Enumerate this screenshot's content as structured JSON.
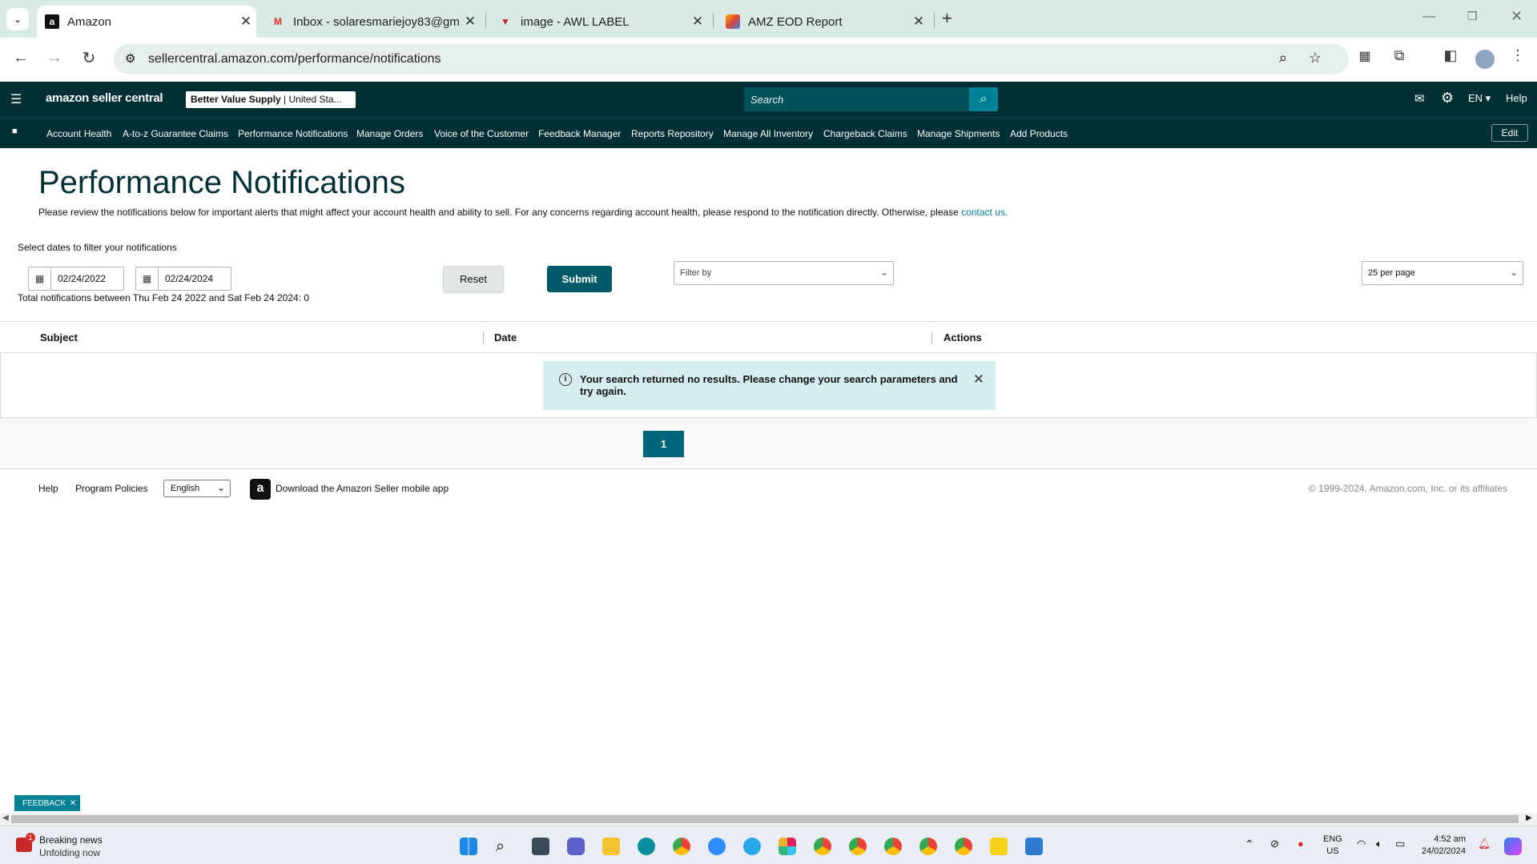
{
  "browser": {
    "tabs": [
      {
        "title": "Amazon",
        "active": true
      },
      {
        "title": "Inbox - solaresmariejoy83@gm",
        "active": false
      },
      {
        "title": "image - AWL LABEL",
        "active": false
      },
      {
        "title": "AMZ EOD Report",
        "active": false
      }
    ],
    "new_tab": "+",
    "url": "sellercentral.amazon.com/performance/notifications"
  },
  "header": {
    "logo": "amazon seller central",
    "store_name": "Better Value Supply",
    "store_region": "United Sta...",
    "search_placeholder": "Search",
    "language": "EN",
    "help": "Help"
  },
  "nav": {
    "items": [
      "Account Health",
      "A-to-z Guarantee Claims",
      "Performance Notifications",
      "Manage Orders",
      "Voice of the Customer",
      "Feedback Manager",
      "Reports Repository",
      "Manage All Inventory",
      "Chargeback Claims",
      "Manage Shipments",
      "Add Products"
    ],
    "edit": "Edit"
  },
  "page": {
    "title": "Performance Notifications",
    "intro": "Please review the notifications below for important alerts that might affect your account health and ability to sell. For any concerns regarding account health, please respond to the notification directly. Otherwise, please ",
    "contact_link": "contact us.",
    "date_filter_label": "Select dates to filter your notifications",
    "start_date": "02/24/2022",
    "end_date": "02/24/2024",
    "total_text": "Total notifications between Thu Feb 24 2022 and Sat Feb 24 2024: 0",
    "reset": "Reset",
    "submit": "Submit",
    "filter_placeholder": "Filter by",
    "per_page": "25 per page"
  },
  "table": {
    "columns": [
      "Subject",
      "Date",
      "Actions"
    ],
    "empty_message": "Your search returned no results. Please change your search parameters and try again."
  },
  "pagination": {
    "current": "1"
  },
  "footer": {
    "help": "Help",
    "policies": "Program Policies",
    "language": "English",
    "app_link": "Download the Amazon Seller mobile app",
    "copyright": "© 1999-2024, Amazon.com, Inc. or its affiliates"
  },
  "feedback": "FEEDBACK",
  "taskbar": {
    "news_title": "Breaking news",
    "news_sub": "Unfolding now",
    "news_badge": "1",
    "lang_top": "ENG",
    "lang_bottom": "US",
    "time": "4:52 am",
    "date": "24/02/2024"
  },
  "colors": {
    "header_bg": "#002f36",
    "accent": "#008296",
    "submit": "#005a67",
    "tabstrip": "#d9e9e5"
  }
}
